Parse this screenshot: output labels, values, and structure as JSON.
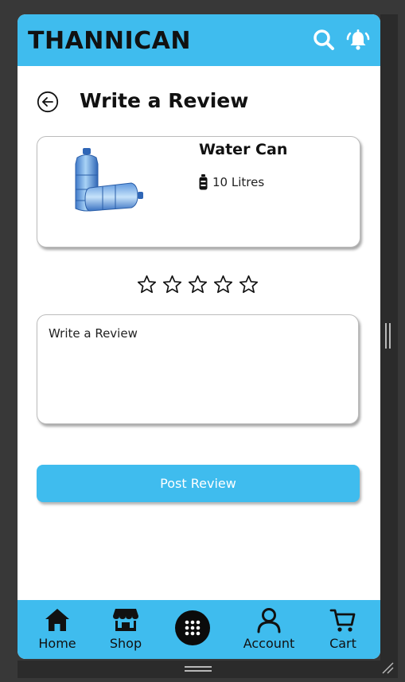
{
  "header": {
    "brand": "THANNICAN",
    "search_icon": "search-icon",
    "notification_icon": "bell-ringing-icon"
  },
  "page": {
    "back_icon": "back-arrow-icon",
    "title": "Write a Review"
  },
  "product": {
    "name": "Water Can",
    "quantity": "10 Litres",
    "quantity_icon": "bottle-icon",
    "image": "water-can-image"
  },
  "rating": {
    "max_stars": 5,
    "selected": 0
  },
  "review": {
    "placeholder": "Write a Review",
    "value": ""
  },
  "actions": {
    "post_label": "Post Review"
  },
  "bottom_nav": {
    "items": [
      {
        "label": "Home",
        "icon": "home-icon"
      },
      {
        "label": "Shop",
        "icon": "shop-icon"
      },
      {
        "label": "",
        "icon": "grid-menu-icon"
      },
      {
        "label": "Account",
        "icon": "account-icon"
      },
      {
        "label": "Cart",
        "icon": "cart-icon"
      }
    ]
  },
  "colors": {
    "accent": "#3fbcee",
    "background": "#ffffff",
    "frame": "#383838"
  }
}
